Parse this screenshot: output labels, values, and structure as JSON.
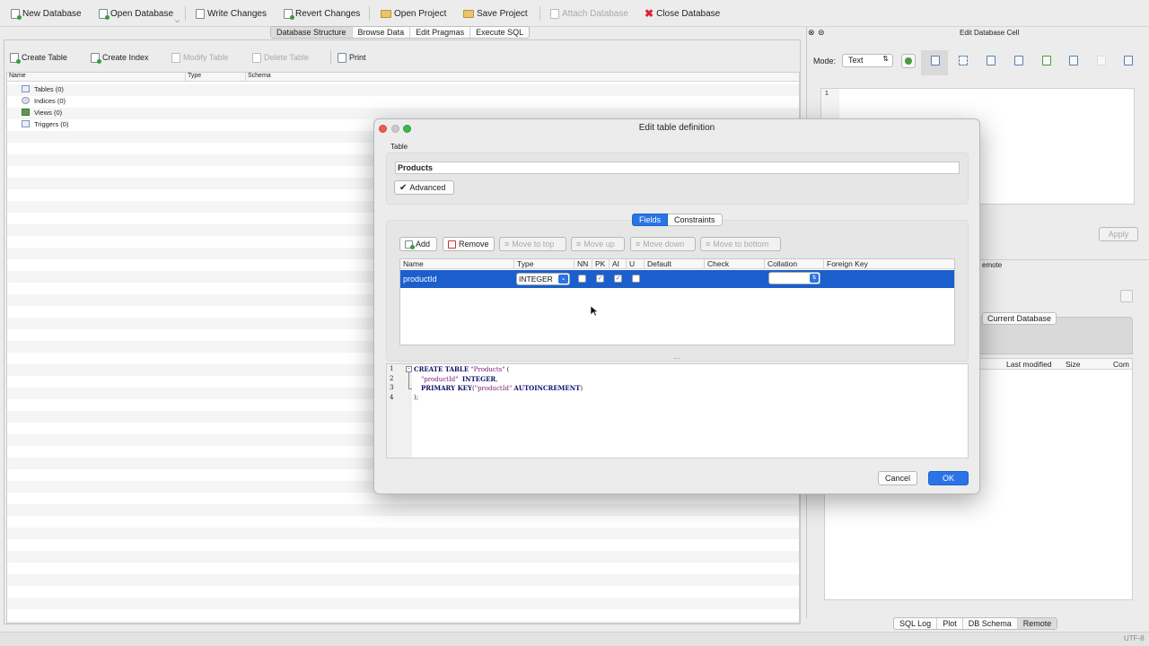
{
  "toolbar": {
    "new_database": "New Database",
    "open_database": "Open Database",
    "write_changes": "Write Changes",
    "revert_changes": "Revert Changes",
    "open_project": "Open Project",
    "save_project": "Save Project",
    "attach_database": "Attach Database",
    "close_database": "Close Database"
  },
  "main_tabs": [
    "Database Structure",
    "Browse Data",
    "Edit Pragmas",
    "Execute SQL"
  ],
  "structure_toolbar": {
    "create_table": "Create Table",
    "create_index": "Create Index",
    "modify_table": "Modify Table",
    "delete_table": "Delete Table",
    "print": "Print"
  },
  "tree_columns": [
    "Name",
    "Type",
    "Schema"
  ],
  "tree_items": [
    "Tables (0)",
    "Indices (0)",
    "Views (0)",
    "Triggers (0)"
  ],
  "edit_cell": {
    "title": "Edit Database Cell",
    "mode_label": "Mode:",
    "mode_value": "Text",
    "line_number": "1",
    "apply": "Apply"
  },
  "remote_panel": {
    "title_fragment": "emote",
    "tab": "Current Database",
    "columns": [
      "Last modified",
      "Size",
      "Com"
    ]
  },
  "bottom_tabs": [
    "SQL Log",
    "Plot",
    "DB Schema",
    "Remote"
  ],
  "status": {
    "encoding": "UTF-8"
  },
  "dialog": {
    "title": "Edit table definition",
    "table_label": "Table",
    "table_name": "Products",
    "advanced": "Advanced",
    "tabs": [
      "Fields",
      "Constraints"
    ],
    "buttons": {
      "add": "Add",
      "remove": "Remove",
      "move_top": "Move to top",
      "move_up": "Move up",
      "move_down": "Move down",
      "move_bottom": "Move to bottom"
    },
    "columns": [
      "Name",
      "Type",
      "NN",
      "PK",
      "AI",
      "U",
      "Default",
      "Check",
      "Collation",
      "Foreign Key"
    ],
    "field": {
      "name": "productId",
      "type": "INTEGER",
      "nn": false,
      "pk": true,
      "ai": true,
      "u": false
    },
    "sql_line_numbers": [
      "1",
      "2",
      "3",
      "4"
    ],
    "sql": {
      "l1_kw": "CREATE TABLE",
      "l1_str": "\"Products\"",
      "l1_end": " (",
      "l2_str": "\"productId\"",
      "l2_kw": "INTEGER",
      "l2_end": ",",
      "l3_kw": "PRIMARY KEY",
      "l3_open": "(",
      "l3_str": "\"productId\"",
      "l3_kw2": "AUTOINCREMENT",
      "l3_end": ")",
      "l4": ");"
    },
    "cancel": "Cancel",
    "ok": "OK"
  },
  "colors": {
    "accent": "#1e5fd6",
    "selection": "#1b5fcc",
    "close_red": "#ed5a52",
    "min_yellow": "#c9c9c9",
    "max_green": "#3db74a"
  }
}
